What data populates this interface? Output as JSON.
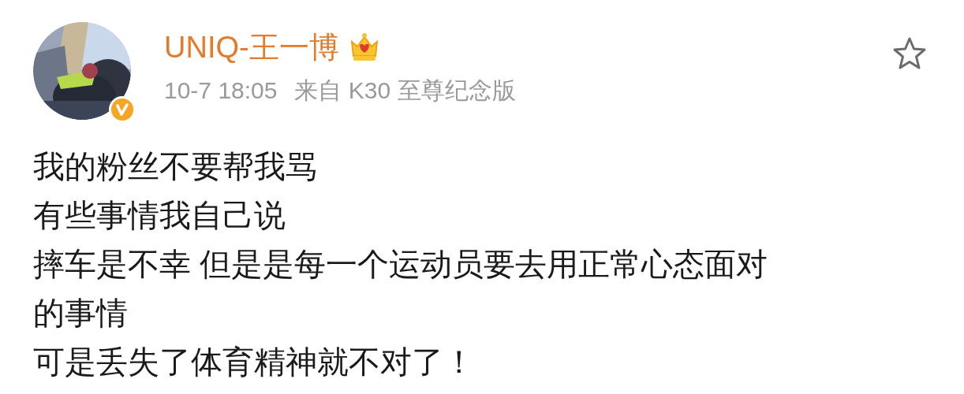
{
  "post": {
    "author": "UNIQ-王一博",
    "verified": true,
    "timestamp": "10-7 18:05",
    "source": "来自 K30 至尊纪念版",
    "favorited": false,
    "lines": [
      "我的粉丝不要帮我骂",
      "有些事情我自己说",
      "摔车是不幸 但是是每一个运动员要去用正常心态面对",
      "的事情",
      "可是丢失了体育精神就不对了！"
    ]
  }
}
